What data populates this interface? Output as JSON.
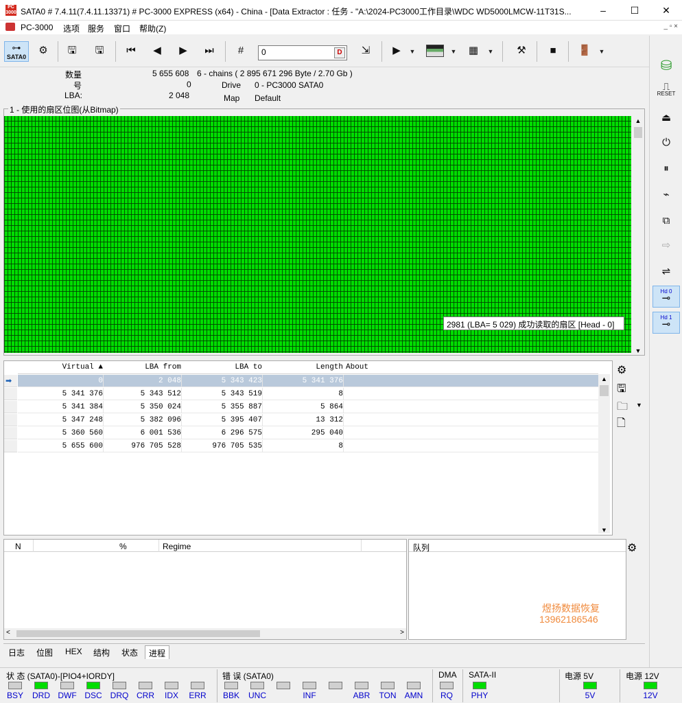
{
  "title": {
    "text": "SATA0 # 7.4.11(7.4.11.13371) # PC-3000 EXPRESS (x64) - China - [Data Extractor : 任务 - \"A:\\2024-PC3000工作目录\\WDC WD5000LMCW-11T31S...",
    "icon_text": "PC 3000",
    "minimize": "–",
    "maximize": "☐",
    "close": "✕"
  },
  "menu": {
    "items": [
      "PC-3000",
      "选项",
      "服务",
      "窗口",
      "帮助(Z)"
    ],
    "mdi": "_  ▫  ×"
  },
  "toolbar": {
    "sata_label": "SATA0",
    "goto_value": "0",
    "icons": [
      "sata-port",
      "settings-refresh",
      "save-disk",
      "save-disk-alt",
      "go-first",
      "go-prev",
      "go-next",
      "go-last",
      "goto-sector",
      "run",
      "view-bitmap",
      "grid",
      "tools",
      "stop",
      "exit"
    ]
  },
  "info": {
    "count_label": "数量",
    "count_value": "5 655 608",
    "count_detail": "6 - chains  ( 2 895 671 296 Byte /  2.70 Gb )",
    "num_label": "号",
    "num_value": "0",
    "lba_label": "LBA:",
    "lba_value": "2 048",
    "drive_label": "Drive",
    "drive_value": "0 - PC3000 SATA0",
    "map_label": "Map",
    "map_value": "Default"
  },
  "bitmap": {
    "caption": "1 - 使用的扇区位图(从Bitmap)",
    "cell_color": "#00dd00",
    "tooltip": "2981 (LBA=  5 029) 成功读取的扇区 [Head - 0]"
  },
  "table": {
    "columns": [
      "Virtual ▲",
      "LBA from",
      "LBA to",
      "Length",
      "About"
    ],
    "rows": [
      {
        "virtual": "0",
        "from": "2 048",
        "to": "5 343 423",
        "length": "5 341 376",
        "about": ""
      },
      {
        "virtual": "5 341 376",
        "from": "5 343 512",
        "to": "5 343 519",
        "length": "8",
        "about": ""
      },
      {
        "virtual": "5 341 384",
        "from": "5 350 024",
        "to": "5 355 887",
        "length": "5 864",
        "about": ""
      },
      {
        "virtual": "5 347 248",
        "from": "5 382 096",
        "to": "5 395 407",
        "length": "13 312",
        "about": ""
      },
      {
        "virtual": "5 360 560",
        "from": "6 001 536",
        "to": "6 296 575",
        "length": "295 040",
        "about": ""
      },
      {
        "virtual": "5 655 600",
        "from": "976 705 528",
        "to": "976 705 535",
        "length": "8",
        "about": ""
      }
    ]
  },
  "process": {
    "col_n": "N",
    "col_pct": "%",
    "col_regime": "Regime",
    "queue_label": "队列"
  },
  "watermark": {
    "line1": "煜扬数据恢复",
    "line2": "13962186546"
  },
  "tabs": [
    "日志",
    "位图",
    "HEX",
    "结构",
    "状态",
    "进程"
  ],
  "active_tab": "进程",
  "status": {
    "state_title": "状 态 (SATA0)-[PIO4+IORDY]",
    "error_title": "错 误 (SATA0)",
    "dma_title": "DMA",
    "sata_title": "SATA-II",
    "p5_title": "电源 5V",
    "p12_title": "电源 12V",
    "state_leds": [
      {
        "label": "BSY",
        "on": false
      },
      {
        "label": "DRD",
        "on": true
      },
      {
        "label": "DWF",
        "on": false
      },
      {
        "label": "DSC",
        "on": true
      },
      {
        "label": "DRQ",
        "on": false
      },
      {
        "label": "CRR",
        "on": false
      },
      {
        "label": "IDX",
        "on": false
      },
      {
        "label": "ERR",
        "on": false
      }
    ],
    "error_leds": [
      {
        "label": "BBK",
        "on": false
      },
      {
        "label": "UNC",
        "on": false
      },
      {
        "label": "",
        "on": false
      },
      {
        "label": "INF",
        "on": false
      },
      {
        "label": "",
        "on": false
      },
      {
        "label": "ABR",
        "on": false
      },
      {
        "label": "TON",
        "on": false
      },
      {
        "label": "AMN",
        "on": false
      }
    ],
    "dma_led": {
      "label": "RQ",
      "on": false
    },
    "sata_led": {
      "label": "PHY",
      "on": true
    },
    "p5_led": {
      "label": "5V",
      "on": true
    },
    "p12_led": {
      "label": "12V",
      "on": true
    },
    "led_on_color": "#00dd00"
  },
  "right_toolbar": {
    "reset_label": "RESET",
    "hd0_label": "Hd 0",
    "hd1_label": "Hd 1"
  }
}
